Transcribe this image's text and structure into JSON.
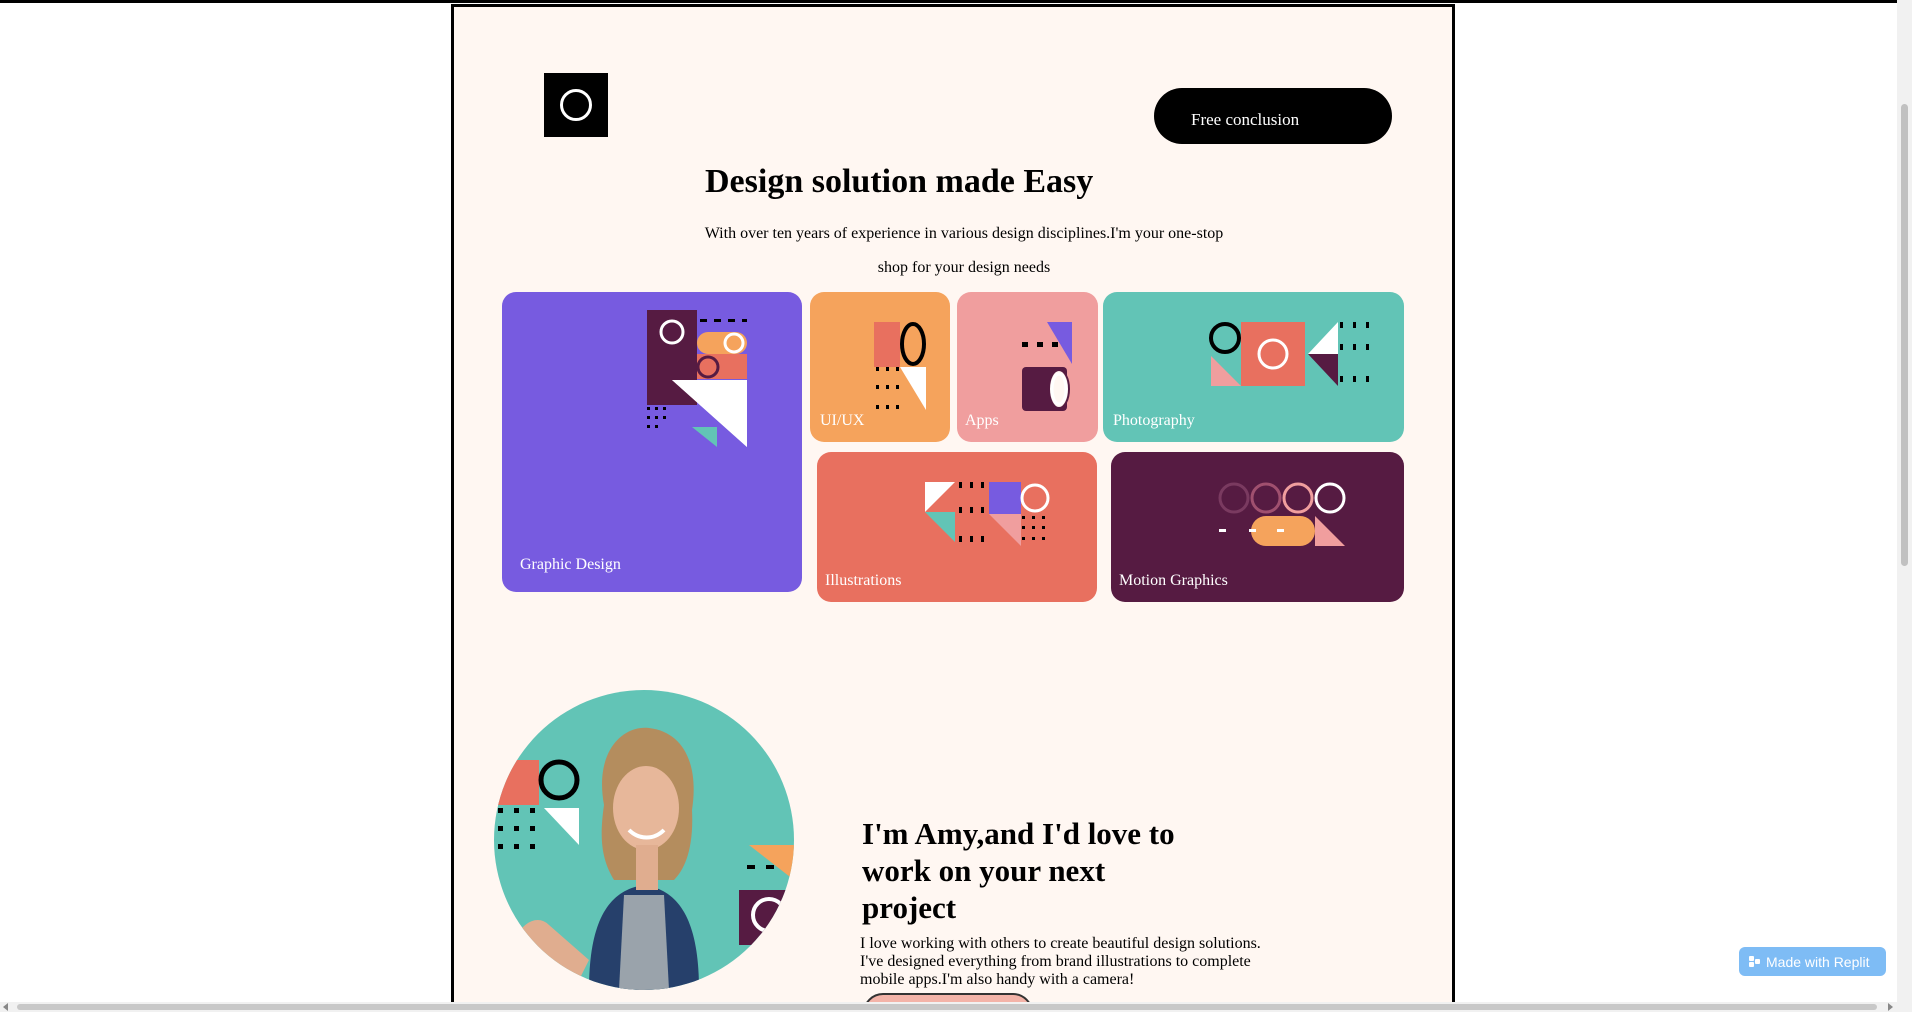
{
  "header": {
    "logo_icon": "circle-logo-icon",
    "cta_label": "Free conclusion"
  },
  "hero": {
    "title": "Design solution made Easy",
    "subtitle": "With over ten years of experience in various design disciplines.I'm your one-stop shop for your design needs"
  },
  "services": {
    "tiles": [
      {
        "label": "Graphic Design",
        "color": "#775be0"
      },
      {
        "label": "UI/UX",
        "color": "#f5a35c"
      },
      {
        "label": "Apps",
        "color": "#f09e9e"
      },
      {
        "label": "Photography",
        "color": "#62c4b6"
      },
      {
        "label": "Illustrations",
        "color": "#e8705f"
      },
      {
        "label": "Motion Graphics",
        "color": "#561b42"
      }
    ]
  },
  "about": {
    "title": "I'm Amy,and I'd love to work on your next project",
    "text": "I love working with others to create beautiful design solutions. I've designed everything from brand illustrations to complete mobile apps.I'm also handy with a camera!"
  },
  "badge": {
    "label": "Made with Replit"
  },
  "colors": {
    "page_bg": "#fff7f2",
    "purple": "#775be0",
    "orange": "#f5a35c",
    "pink": "#f09e9e",
    "teal": "#62c4b6",
    "coral": "#e8705f",
    "plum": "#561b42"
  }
}
